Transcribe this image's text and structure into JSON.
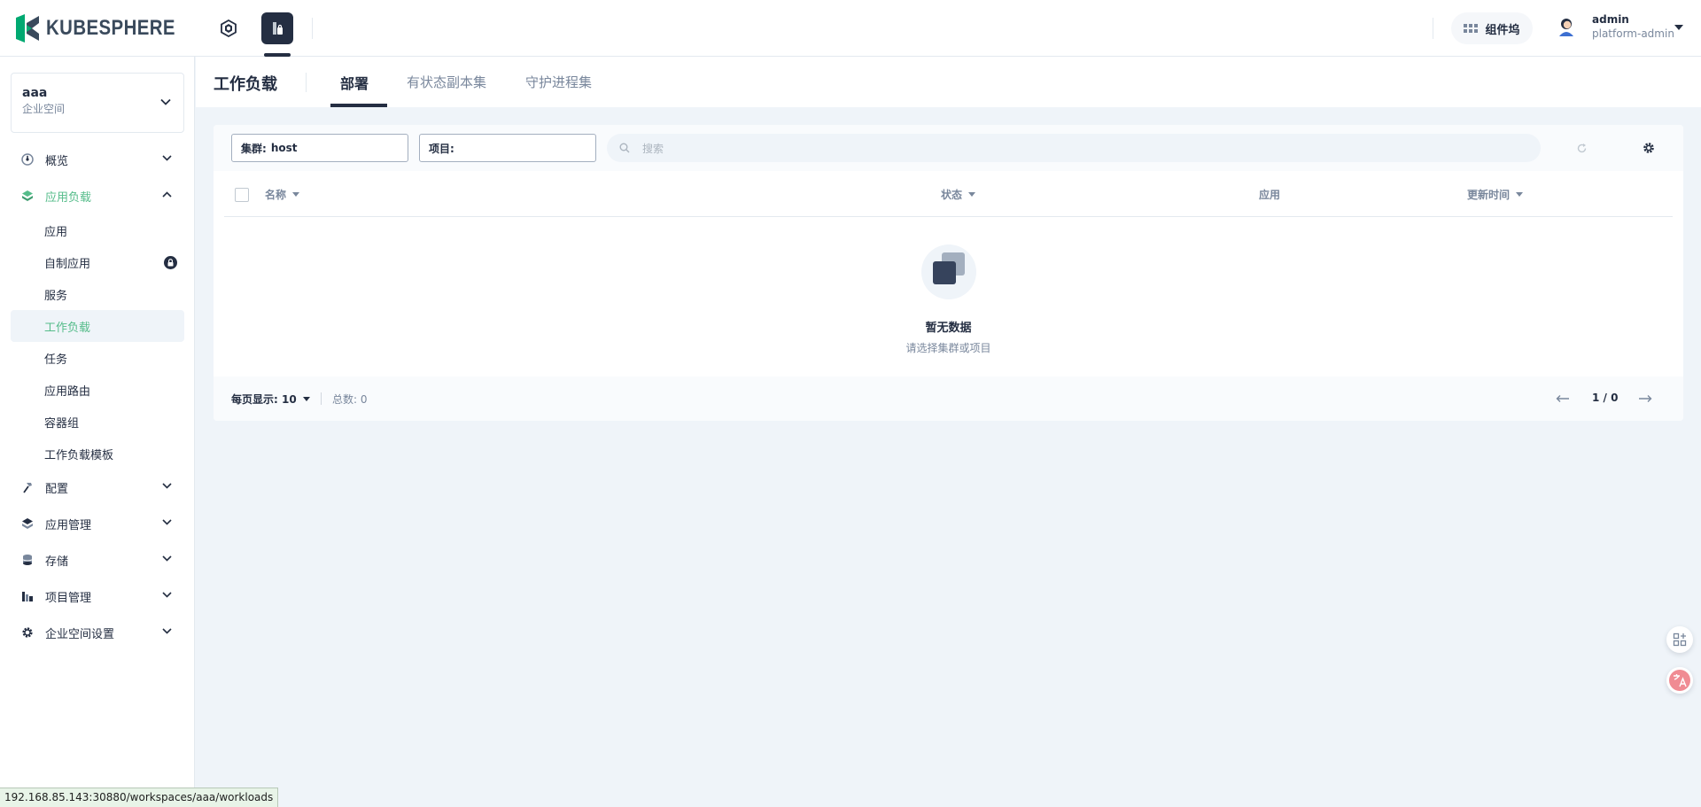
{
  "header": {
    "logo_text": "KUBESPHERE",
    "nav_icons": [
      "cluster-nav-icon",
      "workspace-nav-icon"
    ],
    "components_label": "组件坞",
    "user": {
      "name": "admin",
      "role": "platform-admin"
    }
  },
  "workspace": {
    "name": "aaa",
    "type": "企业空间"
  },
  "sidebar": {
    "items": [
      {
        "label": "概览",
        "icon": "overview-icon",
        "expanded": false
      },
      {
        "label": "应用负载",
        "icon": "app-workloads-icon",
        "expanded": true,
        "children": [
          "应用",
          "自制应用",
          "服务",
          "工作负载",
          "任务",
          "应用路由",
          "容器组",
          "工作负载模板"
        ],
        "active_child": "工作负载"
      },
      {
        "label": "配置",
        "icon": "config-icon",
        "expanded": false
      },
      {
        "label": "应用管理",
        "icon": "app-management-icon",
        "expanded": false
      },
      {
        "label": "存储",
        "icon": "storage-icon",
        "expanded": false
      },
      {
        "label": "项目管理",
        "icon": "project-management-icon",
        "expanded": false
      },
      {
        "label": "企业空间设置",
        "icon": "workspace-settings-icon",
        "expanded": false
      }
    ]
  },
  "page": {
    "title": "工作负载",
    "tabs": [
      "部署",
      "有状态副本集",
      "守护进程集"
    ],
    "active_tab": "部署"
  },
  "filters": {
    "cluster_label": "集群:",
    "cluster_value": "host",
    "project_label": "项目:",
    "project_value": "",
    "search_placeholder": "搜索"
  },
  "table": {
    "columns": [
      "名称",
      "状态",
      "应用",
      "更新时间"
    ],
    "rows": [],
    "empty_title": "暂无数据",
    "empty_desc": "请选择集群或项目"
  },
  "pagination": {
    "page_size_label": "每页显示: 10",
    "total_label": "总数: 0",
    "page_indicator": "1 / 0"
  },
  "status_url": "192.168.85.143:30880/workspaces/aaa/workloads",
  "colors": {
    "accent": "#55bc8a",
    "dark": "#242e42",
    "muted": "#79879c",
    "page_bg": "#eff4f9"
  }
}
